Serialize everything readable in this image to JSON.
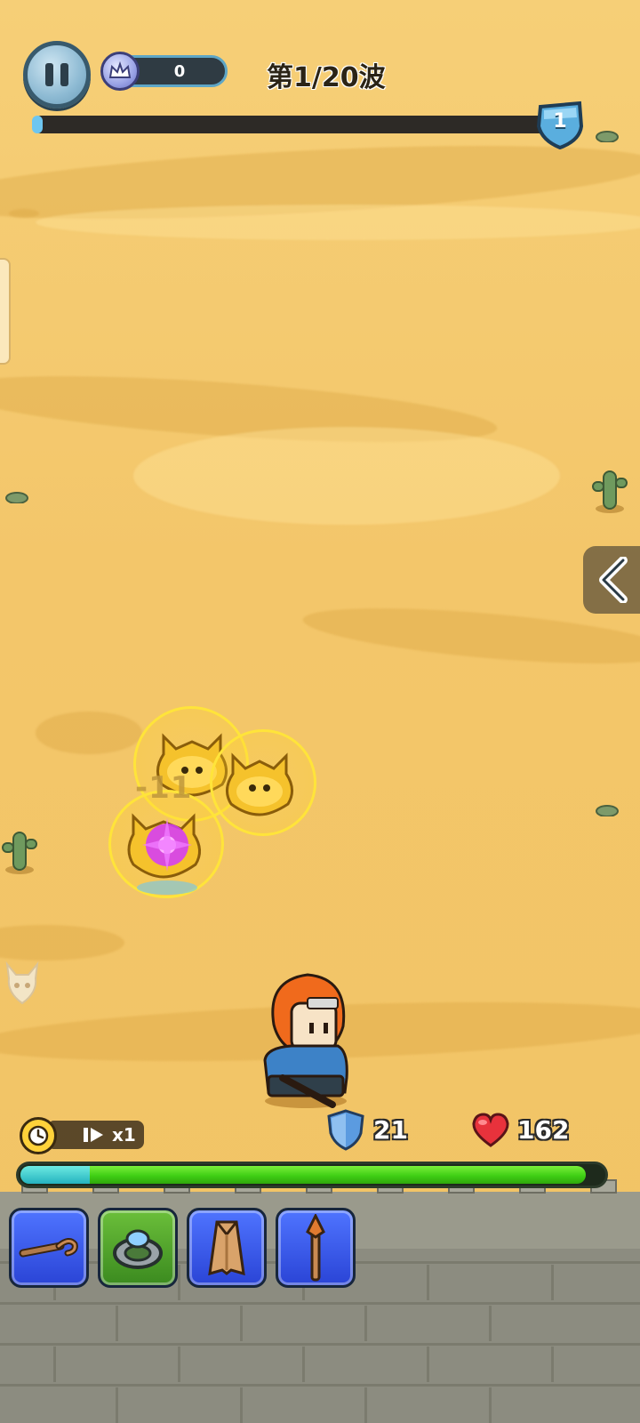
{
  "hud": {
    "score": "0",
    "wave_label": "第1/20波",
    "wave_progress": 0.02,
    "wave_number": "1",
    "speed_label": "x1"
  },
  "stats": {
    "shield": "21",
    "health": "162"
  },
  "combat": {
    "damage_text": "-11"
  },
  "base_hp_fraction": 0.97,
  "skills": [
    {
      "name": "staff-icon",
      "color": "blue"
    },
    {
      "name": "ring-icon",
      "color": "green"
    },
    {
      "name": "cloak-icon",
      "color": "blue"
    },
    {
      "name": "spear-icon",
      "color": "blue"
    }
  ],
  "colors": {
    "sand": "#f3c66a",
    "hp_green": "#3fcf14",
    "wave_blue": "#6ec6f0"
  }
}
